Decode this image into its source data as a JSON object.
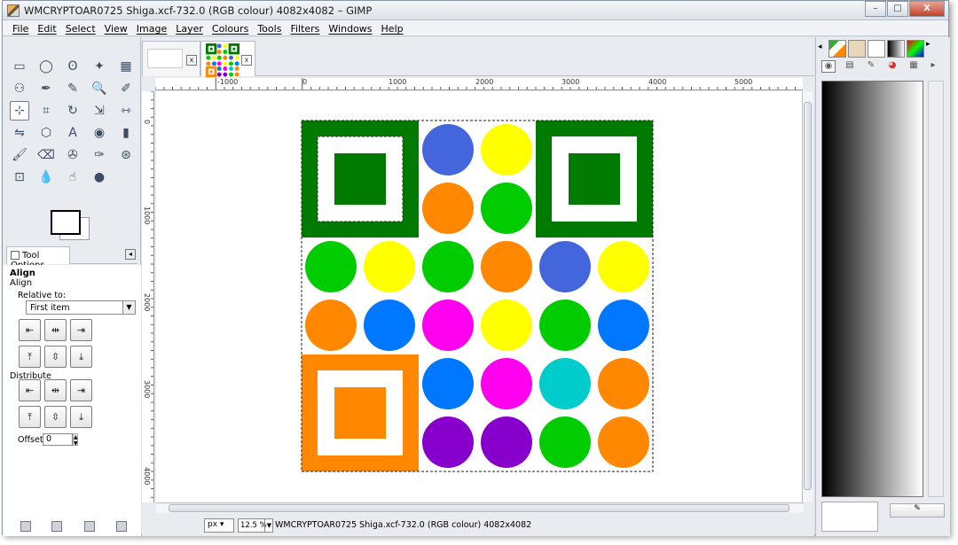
{
  "window": {
    "title": "WMCRYPTOAR0725 Shiga.xcf-732.0 (RGB colour) 4082x4082 – GIMP"
  },
  "window_controls": {
    "minimize": "–",
    "maximize": "□",
    "close": "X"
  },
  "menu": [
    "File",
    "Edit",
    "Select",
    "View",
    "Image",
    "Layer",
    "Colours",
    "Tools",
    "Filters",
    "Windows",
    "Help"
  ],
  "toolbox": {
    "tools": [
      "rect-select",
      "ellipse-select",
      "free-select",
      "fuzzy-select",
      "by-color-select",
      "scissors-select",
      "foreground-select",
      "paths",
      "color-picker",
      "zoom",
      "measure",
      "move",
      "align",
      "crop",
      "rotate",
      "scale",
      "shear",
      "perspective",
      "flip",
      "cage",
      "text",
      "bucket-fill",
      "blend",
      "pencil",
      "paintbrush",
      "eraser",
      "airbrush",
      "ink",
      "clone",
      "heal",
      "perspective-clone",
      "blur",
      "smudge",
      "dodge-burn"
    ],
    "tool_glyphs": [
      "▭",
      "◯",
      "ʘ",
      "✦",
      "▦",
      "✂",
      "⚇",
      "✒",
      "✎",
      "🔍",
      "✐",
      "✥",
      "⊹",
      "⌗",
      "↻",
      "⇲",
      "⇿",
      "▱",
      "⇋",
      "⬡",
      "A",
      "◉",
      "▮",
      "✏",
      "🖌",
      "⌫",
      "✇",
      "✑",
      "⊛",
      "✚",
      "⊡",
      "💧",
      "☝",
      "●"
    ],
    "selected_tool_index": 12
  },
  "tool_options": {
    "tab_label": "Tool Options",
    "title": "Align",
    "subtitle": "Align",
    "relative_to_label": "Relative to:",
    "relative_to_value": "First item",
    "distribute_label": "Distribute",
    "offset_label": "Offset:",
    "offset_value": "0",
    "align_buttons": [
      "⇤",
      "⇹",
      "⇥",
      "⤒",
      "⇳",
      "⤓"
    ],
    "distribute_buttons": [
      "⇤",
      "⇹",
      "⇥",
      "⤒",
      "⇳",
      "⤓"
    ]
  },
  "image_tabs": [
    {
      "close": "x"
    },
    {
      "close": "x"
    }
  ],
  "ruler": {
    "h_labels": [
      "-1000",
      "0",
      "1000",
      "2000",
      "3000",
      "4000",
      "5000"
    ],
    "v_labels": [
      "0",
      "1000",
      "2000",
      "3000",
      "4000"
    ]
  },
  "statusbar": {
    "unit": "px",
    "zoom": "12.5 %",
    "message": "WMCRYPTOAR0725 Shiga.xcf-732.0 (RGB colour) 4082x4082"
  },
  "artwork": {
    "colors": {
      "green": "#007a00",
      "orange": "#ff8800",
      "blue": "#4466dd",
      "yellow": "#ffff00",
      "lime": "#00cc00",
      "azure": "#0077ff",
      "magenta": "#ff00ee",
      "cyan": "#00cccc",
      "purple": "#8800cc"
    },
    "circles": [
      [
        "",
        "",
        "blue",
        "yellow",
        "",
        ""
      ],
      [
        "",
        "",
        "orange",
        "lime",
        "",
        ""
      ],
      [
        "lime",
        "yellow",
        "lime",
        "orange",
        "blue",
        "yellow"
      ],
      [
        "orange",
        "azure",
        "magenta",
        "yellow",
        "lime",
        "azure"
      ],
      [
        "",
        "",
        "azure",
        "magenta",
        "cyan",
        "orange"
      ],
      [
        "",
        "",
        "purple",
        "purple",
        "lime",
        "orange"
      ]
    ]
  }
}
